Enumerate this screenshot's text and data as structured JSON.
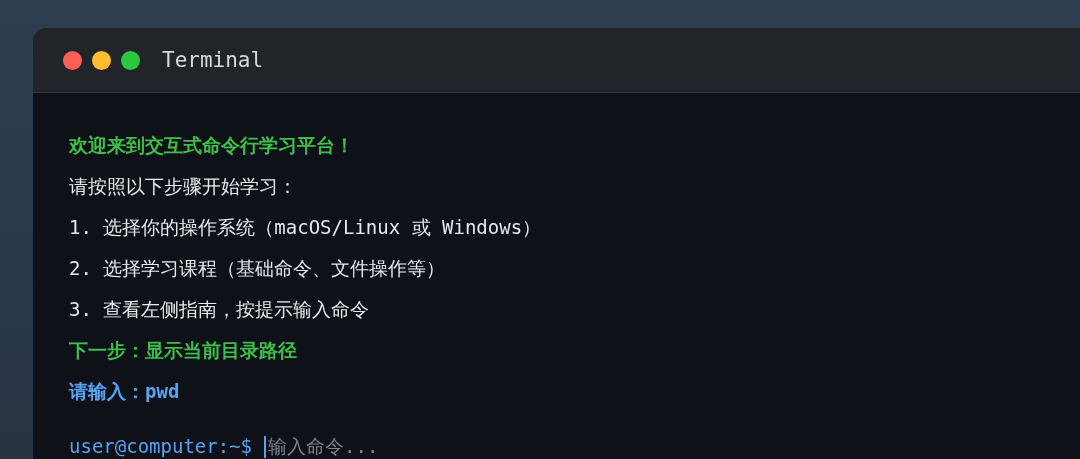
{
  "window": {
    "title": "Terminal"
  },
  "lines": [
    {
      "kind": "success",
      "text": "欢迎来到交互式命令行学习平台！"
    },
    {
      "kind": "info",
      "text": "请按照以下步骤开始学习："
    },
    {
      "kind": "info",
      "text": "1. 选择你的操作系统（macOS/Linux 或 Windows）"
    },
    {
      "kind": "info",
      "text": "2. 选择学习课程（基础命令、文件操作等）"
    },
    {
      "kind": "info",
      "text": "3. 查看左侧指南，按提示输入命令"
    },
    {
      "kind": "success",
      "text": "下一步：显示当前目录路径"
    },
    {
      "kind": "prompt",
      "text": "请输入：pwd"
    }
  ],
  "prompt": {
    "label": "user@computer:~$",
    "placeholder": "输入命令..."
  }
}
